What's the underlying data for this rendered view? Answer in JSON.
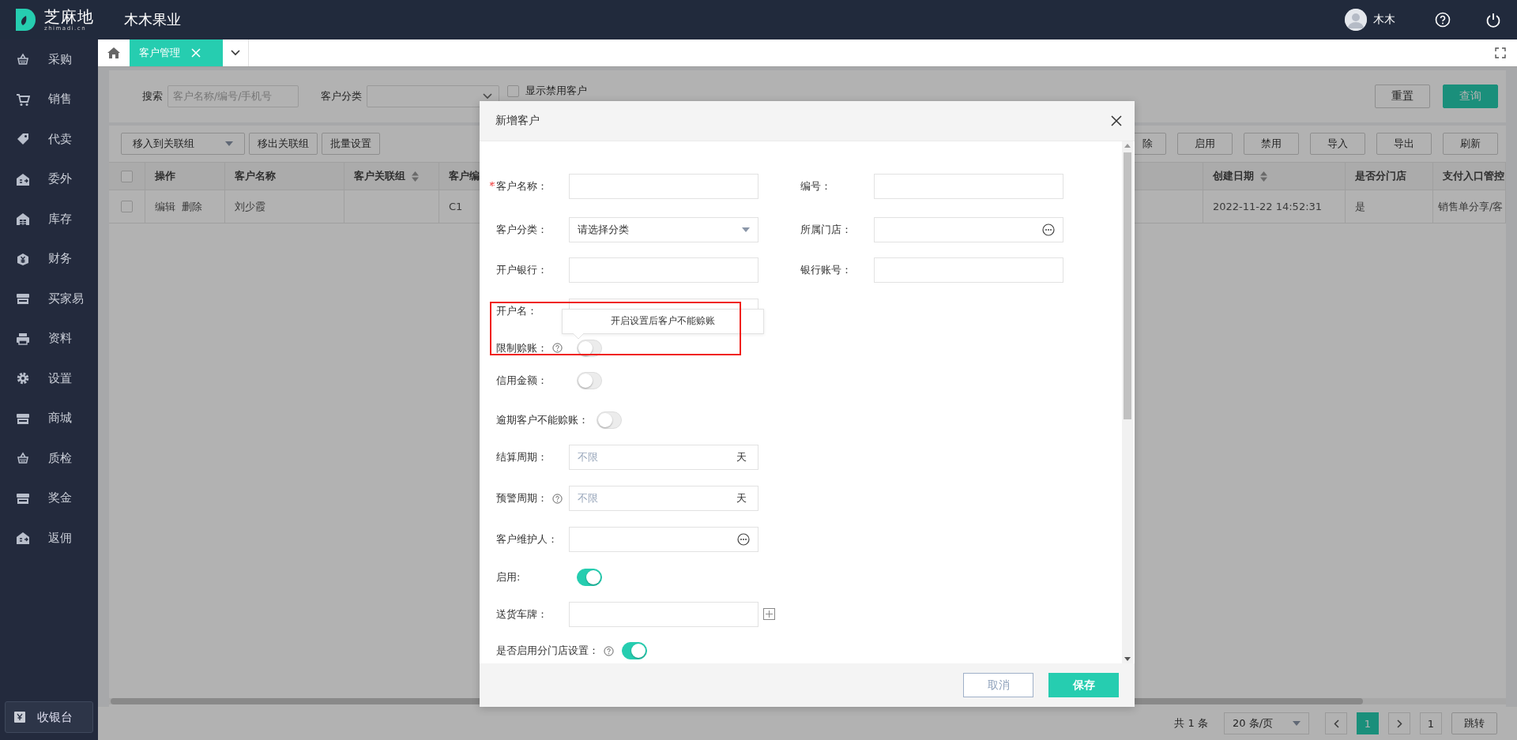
{
  "app": {
    "logo_text": "芝麻地",
    "logo_domain": "zhimadi.cn",
    "company": "木木果业",
    "user": "木木"
  },
  "sidebar": {
    "items": [
      {
        "label": "采购"
      },
      {
        "label": "销售"
      },
      {
        "label": "代卖"
      },
      {
        "label": "委外"
      },
      {
        "label": "库存"
      },
      {
        "label": "财务"
      },
      {
        "label": "买家易"
      },
      {
        "label": "资料"
      },
      {
        "label": "设置"
      },
      {
        "label": "商城"
      },
      {
        "label": "质检"
      },
      {
        "label": "奖金"
      },
      {
        "label": "返佣"
      }
    ],
    "cashier": "收银台"
  },
  "tabs": [
    {
      "label": "客户管理",
      "selected": true
    }
  ],
  "filters": {
    "search_label": "搜索",
    "search_placeholder": "客户名称/编号/手机号",
    "category_label": "客户分类",
    "show_disabled": {
      "label": "显示禁用客户",
      "checked": false
    },
    "buttons": [
      {
        "label": "重置",
        "kind": "default"
      },
      {
        "label": "查询",
        "kind": "primary"
      }
    ]
  },
  "toolbar": {
    "left": [
      {
        "label": "移入到关联组",
        "kind": "dropdown"
      },
      {
        "label": "移出关联组",
        "kind": "default"
      },
      {
        "label": "批量设置",
        "kind": "default"
      }
    ],
    "right": [
      {
        "label": "除"
      },
      {
        "label": "启用"
      },
      {
        "label": "禁用"
      },
      {
        "label": "导入"
      },
      {
        "label": "导出"
      },
      {
        "label": "刷新"
      }
    ]
  },
  "table": {
    "select_all": false,
    "action_column": "操作",
    "columns": [
      {
        "label": "客户名称",
        "sortable": false
      },
      {
        "label": "客户关联组",
        "sortable": true
      },
      {
        "label": "客户编",
        "sortable": false
      },
      {
        "label": "创建日期",
        "sortable": true
      },
      {
        "label": "是否分门店",
        "sortable": false
      },
      {
        "label": "支付入口管控",
        "sortable": false
      }
    ],
    "rows": [
      {
        "checked": false,
        "actions": [
          "编辑",
          "删除"
        ],
        "cells": [
          "刘少霞",
          "",
          "C1",
          "2022-11-22 14:52:31",
          "是",
          "销售单分享/客"
        ]
      }
    ]
  },
  "pagination": {
    "total": "共 1 条",
    "page_size": "20 条/页",
    "pages": [
      {
        "label": "1",
        "selected": true
      }
    ],
    "jump_value": "1",
    "jump_label": "跳转"
  },
  "dialog": {
    "title": "新增客户",
    "rows": [
      {
        "fields": [
          {
            "label": "客户名称：",
            "kind": "text",
            "required": true,
            "help": false
          },
          {
            "label": "编号：",
            "kind": "text",
            "required": false,
            "help": false
          }
        ]
      },
      {
        "fields": [
          {
            "label": "客户分类：",
            "kind": "select",
            "value": "请选择分类",
            "required": false,
            "help": false
          },
          {
            "label": "所属门店：",
            "kind": "picker",
            "required": false,
            "help": false
          }
        ]
      },
      {
        "fields": [
          {
            "label": "开户银行：",
            "kind": "text",
            "required": false,
            "help": false
          },
          {
            "label": "银行账号：",
            "kind": "text",
            "required": false,
            "help": false
          }
        ]
      },
      {
        "fields": [
          {
            "label": "开户名：",
            "kind": "text",
            "required": false,
            "help": false
          }
        ]
      },
      {
        "fields": [
          {
            "label": "限制赊账：",
            "kind": "toggle",
            "on": false,
            "required": false,
            "help": true,
            "tooltip": "开启设置后客户不能赊账"
          }
        ]
      },
      {
        "fields": [
          {
            "label": "信用金额：",
            "kind": "toggle",
            "on": false,
            "required": false,
            "help": false
          }
        ]
      },
      {
        "fields": [
          {
            "label": "逾期客户不能赊账：",
            "kind": "toggle",
            "on": false,
            "required": false,
            "help": false
          }
        ]
      },
      {
        "fields": [
          {
            "label": "结算周期：",
            "kind": "unit",
            "placeholder": "不限",
            "unit": "天",
            "required": false,
            "help": false
          }
        ]
      },
      {
        "fields": [
          {
            "label": "预警周期：",
            "kind": "unit",
            "placeholder": "不限",
            "unit": "天",
            "required": false,
            "help": true
          }
        ]
      },
      {
        "fields": [
          {
            "label": "客户维护人：",
            "kind": "picker",
            "required": false,
            "help": false
          }
        ]
      },
      {
        "fields": [
          {
            "label": "启用:",
            "kind": "toggle",
            "on": true,
            "required": false,
            "help": false
          }
        ]
      },
      {
        "fields": [
          {
            "label": "送货车牌：",
            "kind": "plate",
            "required": false,
            "help": false
          }
        ]
      },
      {
        "fields": [
          {
            "label": "是否启用分门店设置：",
            "kind": "toggle",
            "on": true,
            "required": false,
            "help": true
          }
        ]
      }
    ],
    "buttons": [
      {
        "label": "取消",
        "kind": "default"
      },
      {
        "label": "保存",
        "kind": "primary"
      }
    ]
  }
}
